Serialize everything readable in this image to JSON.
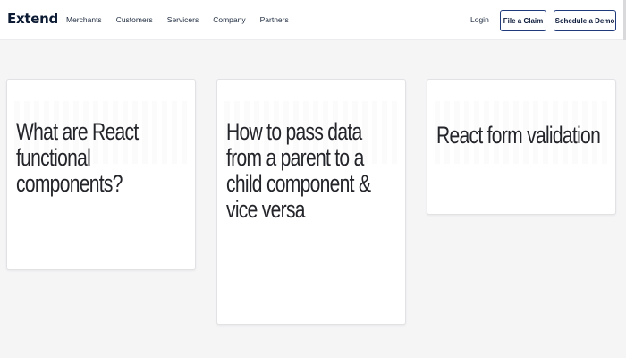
{
  "header": {
    "logo": "Extend",
    "nav": [
      "Merchants",
      "Customers",
      "Servicers",
      "Company",
      "Partners"
    ],
    "login": "Login",
    "file_claim": "File a Claim",
    "schedule_demo": "Schedule a Demo"
  },
  "cards": [
    {
      "title": "What are React functional components?"
    },
    {
      "title": "How to pass data from a parent to a child component & vice versa"
    },
    {
      "title": "React form validation"
    }
  ]
}
